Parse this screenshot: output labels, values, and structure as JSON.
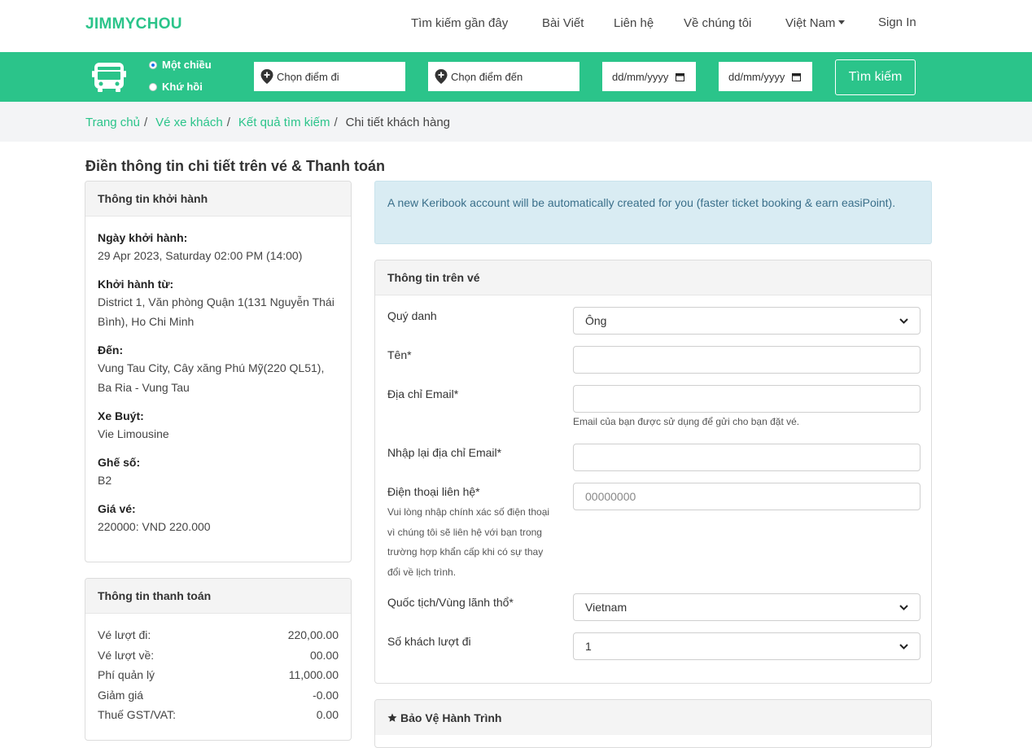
{
  "navbar": {
    "brand": "JIMMYCHOU",
    "links": [
      "Tìm kiếm gần đây",
      "Bài Viết",
      "Liên hệ",
      "Về chúng tôi"
    ],
    "language": "Việt Nam",
    "sign_in": "Sign In"
  },
  "search": {
    "trip_one_way": "Một chiều",
    "trip_round": "Khứ hồi",
    "selected_trip": "Một chiều",
    "from_placeholder": "Chọn điểm đi",
    "to_placeholder": "Chọn điểm đến",
    "depart_date_placeholder": "dd/mm/yyyy",
    "return_date_placeholder": "dd/mm/yyyy",
    "button": "Tìm kiếm",
    "icons": {
      "bus": "bus-icon",
      "pin": "map-pin-icon",
      "calendar": "calendar-icon"
    }
  },
  "breadcrumb": {
    "items": [
      "Trang chủ",
      "Vé xe khách",
      "Kết quả tìm kiếm"
    ],
    "current": "Chi tiết khách hàng",
    "separator": "/"
  },
  "page": {
    "title": "Điền thông tin chi tiết trên vé & Thanh toán"
  },
  "departure_info": {
    "header": "Thông tin khởi hành",
    "fields": [
      {
        "label": "Ngày khởi hành:",
        "value": "29 Apr 2023, Saturday 02:00 PM (14:00)"
      },
      {
        "label": "Khởi hành từ:",
        "value": "District 1, Văn phòng Quận 1(131 Nguyễn Thái Bình), Ho Chi Minh"
      },
      {
        "label": "Đến:",
        "value": "Vung Tau City, Cây xăng Phú Mỹ(220 QL51), Ba Ria - Vung Tau"
      },
      {
        "label": "Xe Buýt:",
        "value": "Vie Limousine"
      },
      {
        "label": "Ghế số:",
        "value": "B2"
      },
      {
        "label": "Giá vé:",
        "value": "220000: VND 220.000"
      }
    ]
  },
  "payment_info": {
    "header": "Thông tin thanh toán",
    "rows": [
      {
        "label": "Vé lượt đi:",
        "value": "220,00.00"
      },
      {
        "label": "Vé lượt về:",
        "value": "00.00"
      },
      {
        "label": "Phí quản lý",
        "value": "11,000.00"
      },
      {
        "label": "Giảm giá",
        "value": "-0.00"
      },
      {
        "label": "Thuế GST/VAT:",
        "value": "0.00"
      }
    ]
  },
  "alert": {
    "text": "A new Keribook account will be automatically created for you (faster ticket booking & earn easiPoint)."
  },
  "ticket_form": {
    "header": "Thông tin trên vé",
    "title_label": "Quý danh",
    "title_value": "Ông",
    "name_label": "Tên*",
    "name_value": "",
    "email_label": "Địa chỉ Email*",
    "email_value": "",
    "email_hint": "Email của bạn được sử dụng để gửi cho bạn đặt vé.",
    "email_confirm_label": "Nhập lại địa chỉ Email*",
    "email_confirm_value": "",
    "phone_label": "Điện thoại liên hệ*",
    "phone_help": "Vui lòng nhập chính xác số điện thoại vì chúng tôi sẽ liên hệ với bạn trong trường hợp khẩn cấp khi có sự thay đổi về lịch trình.",
    "phone_placeholder": "00000000",
    "nationality_label": "Quốc tịch/Vùng lãnh thổ*",
    "nationality_value": "Vietnam",
    "passengers_label": "Số khách lượt đi",
    "passengers_value": "1"
  },
  "protection": {
    "header": "Bảo Vệ Hành Trình",
    "icon": "star-icon"
  },
  "colors": {
    "accent": "#2bc48a",
    "alert_bg": "#d9ecf3",
    "alert_text": "#3a6f8a"
  }
}
